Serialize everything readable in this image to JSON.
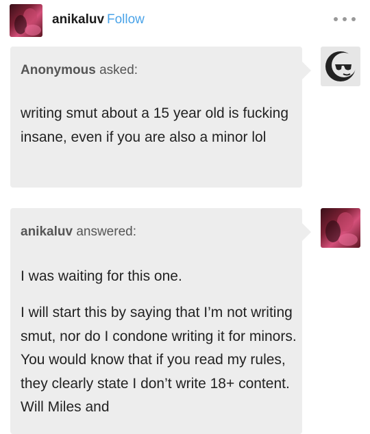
{
  "header": {
    "username": "anikaluv",
    "follow_label": "Follow"
  },
  "question": {
    "asker": "Anonymous",
    "asked_label": "asked:",
    "text": "writing smut about a 15 year old is fucking insane, even if you are also a minor lol"
  },
  "answer": {
    "answerer": "anikaluv",
    "answered_label": "answered:",
    "paragraphs": [
      "I was waiting for this one.",
      "I will start this by saying that I’m not writing smut, nor do I condone writing it for minors. You would know that if you read my rules, they clearly state I don’t write 18+ content. Will Miles and"
    ]
  },
  "icons": {
    "more": "more-horizontal-icon",
    "anon_avatar": "anonymous-sunglasses-avatar-icon"
  },
  "colors": {
    "follow": "#4aa3e8",
    "bubble": "#ededed"
  }
}
